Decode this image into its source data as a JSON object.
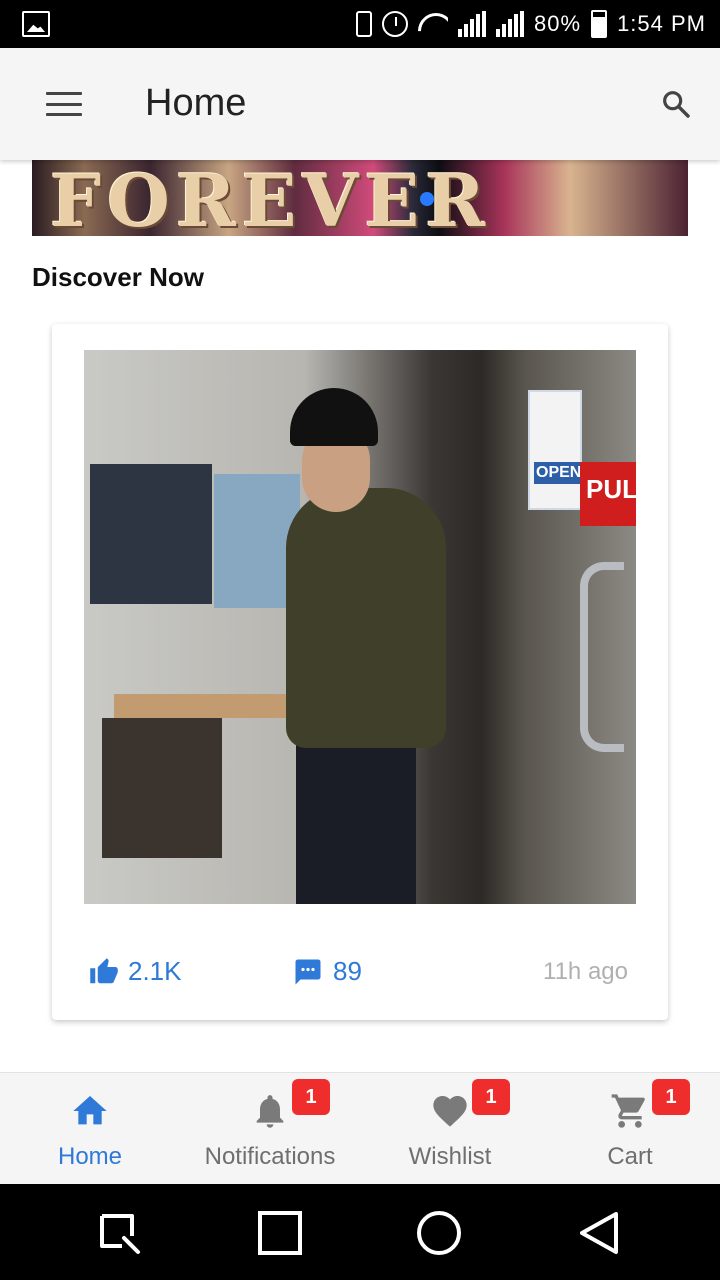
{
  "status_bar": {
    "battery": "80%",
    "time": "1:54 PM",
    "icons": [
      "gallery-icon",
      "vibrate-icon",
      "alarm-icon",
      "wifi-icon",
      "signal-1-icon",
      "signal-2-icon",
      "battery-icon"
    ]
  },
  "app_bar": {
    "title": "Home",
    "menu_icon": "menu-icon",
    "search_icon": "search-icon"
  },
  "banner": {
    "text": "FOREVER",
    "active_dot_color": "#2979ff"
  },
  "section": {
    "title": "Discover Now"
  },
  "post": {
    "likes": "2.1K",
    "comments": "89",
    "time": "11h ago",
    "sign_open": "OPEN",
    "sign_pull": "PULL"
  },
  "bottom_nav": {
    "items": [
      {
        "label": "Home",
        "icon": "home-icon",
        "badge": "",
        "active": true
      },
      {
        "label": "Notifications",
        "icon": "bell-icon",
        "badge": "1",
        "active": false
      },
      {
        "label": "Wishlist",
        "icon": "heart-icon",
        "badge": "1",
        "active": false
      },
      {
        "label": "Cart",
        "icon": "cart-icon",
        "badge": "1",
        "active": false
      }
    ]
  },
  "colors": {
    "accent": "#2f79d8",
    "badge": "#ef2d2d",
    "muted": "#b0b0b0"
  }
}
